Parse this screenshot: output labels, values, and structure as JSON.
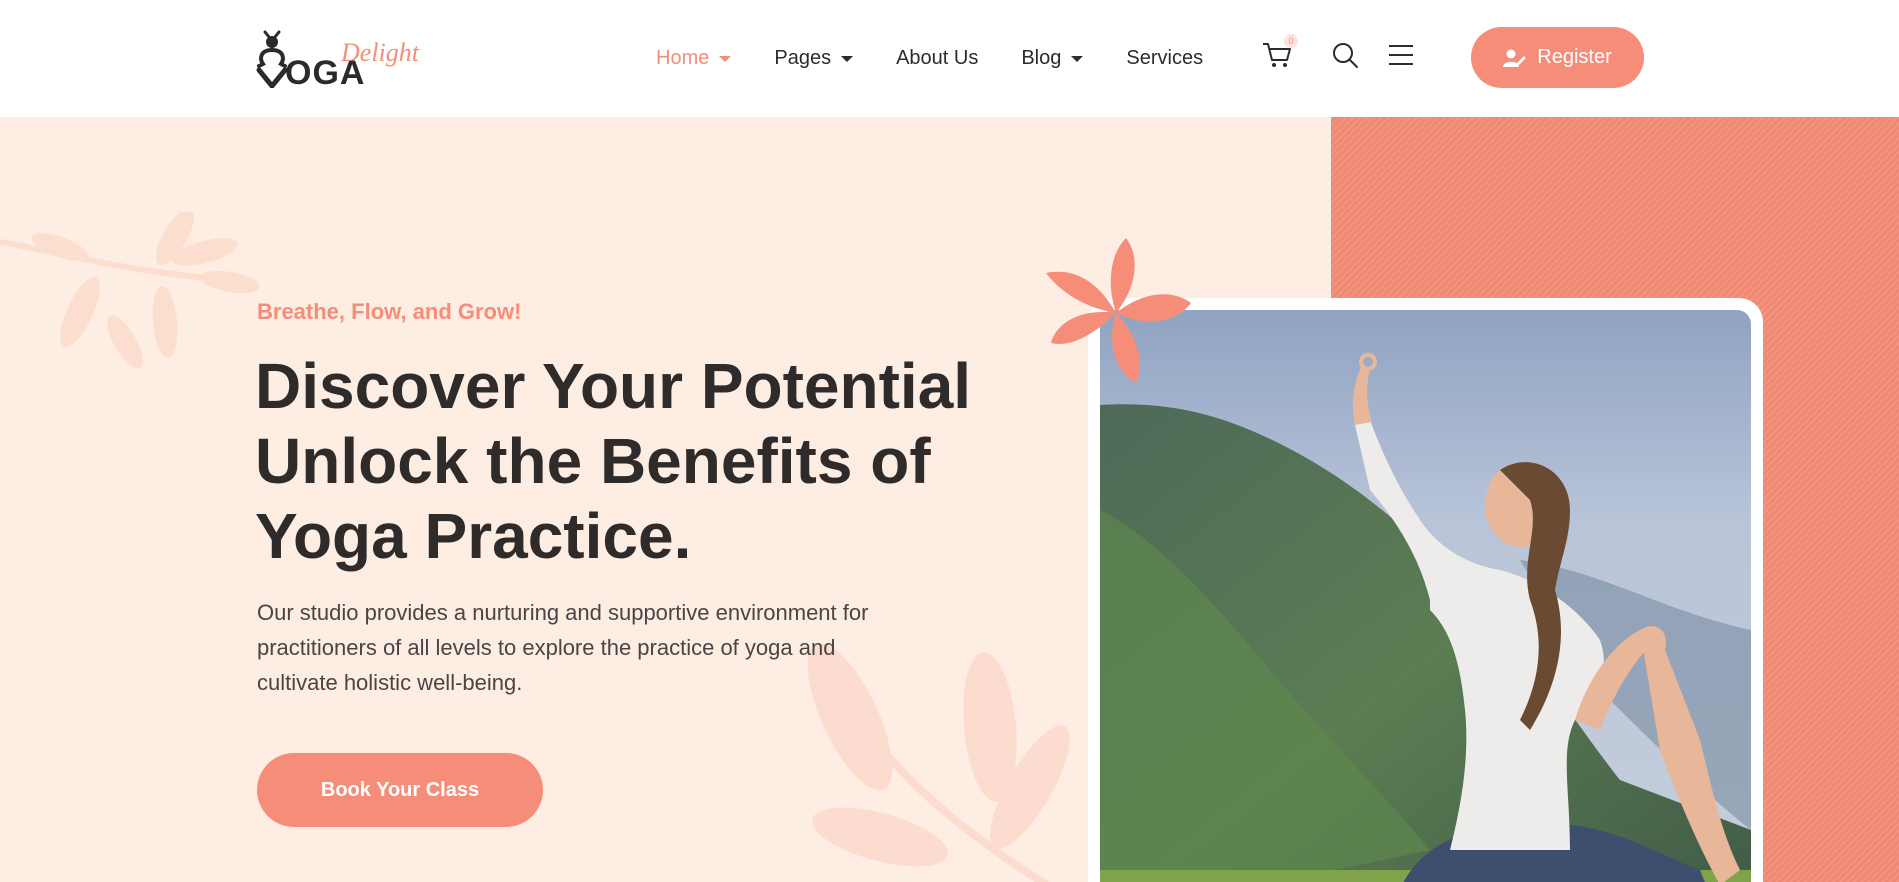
{
  "brand": {
    "logo_word": "OGA",
    "logo_script": "Delight",
    "accent_color": "#f58d78",
    "text_color": "#2f2b2a",
    "hero_bg": "#feede3"
  },
  "nav": {
    "items": [
      {
        "label": "Home",
        "active": true,
        "has_dropdown": true
      },
      {
        "label": "Pages",
        "active": false,
        "has_dropdown": true
      },
      {
        "label": "About Us",
        "active": false,
        "has_dropdown": false
      },
      {
        "label": "Blog",
        "active": false,
        "has_dropdown": true
      },
      {
        "label": "Services",
        "active": false,
        "has_dropdown": false
      }
    ],
    "icons": [
      "cart-icon",
      "search-icon",
      "menu-icon"
    ],
    "cart_count": "0",
    "register_label": "Register",
    "register_icon": "user-edit-icon"
  },
  "hero": {
    "tagline": "Breathe, Flow, and Grow!",
    "headline_lines": [
      "Discover Your Potential",
      "Unlock the Benefits of",
      "Yoga Practice."
    ],
    "description": "Our studio provides a nurturing and supportive environment for practitioners of all levels to explore the practice of yoga and cultivate holistic well-being.",
    "cta_label": "Book Your Class"
  }
}
